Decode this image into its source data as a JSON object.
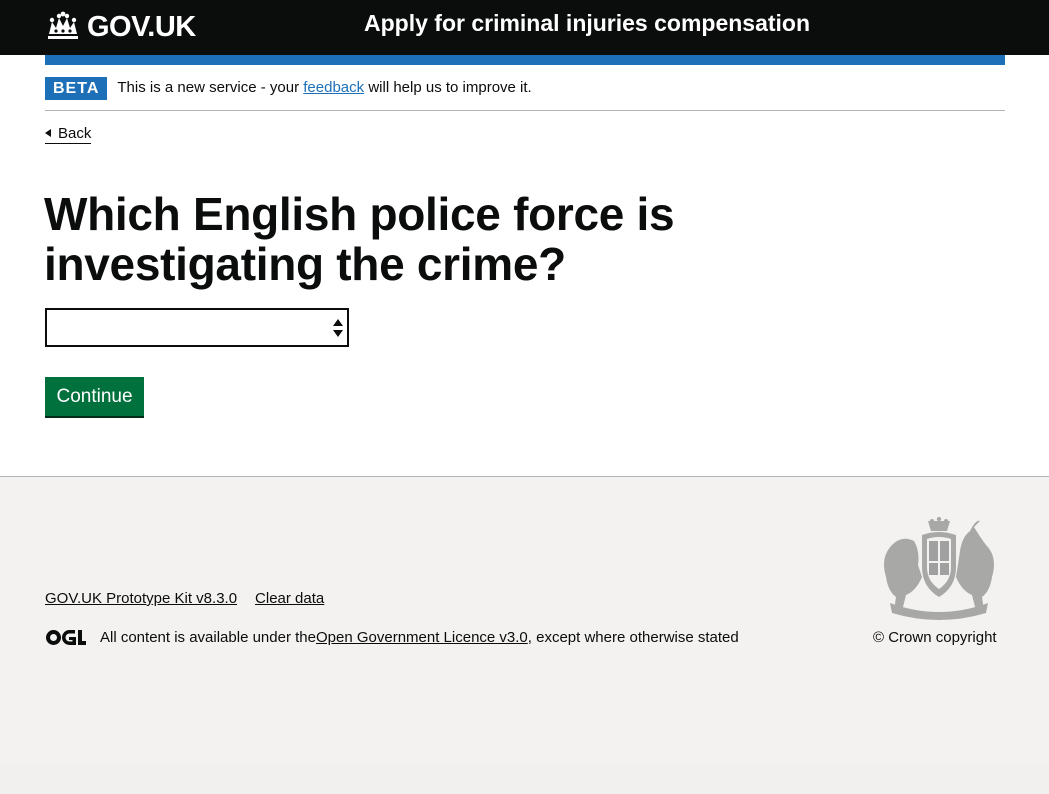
{
  "header": {
    "logo_text": "GOV.UK",
    "service_name": "Apply for criminal injuries compensation"
  },
  "phase_banner": {
    "tag": "BETA",
    "text_before": "This is a new service - your ",
    "link": "feedback",
    "text_after": " will help us to improve it."
  },
  "back_link": "Back",
  "question": "Which English police force is investigating the crime?",
  "select": {
    "value": ""
  },
  "continue_button": "Continue",
  "footer": {
    "links": [
      "GOV.UK Prototype Kit v8.3.0",
      "Clear data"
    ],
    "licence_before": "All content is available under the ",
    "licence_link": "Open Government Licence v3.0",
    "licence_after": ", except where otherwise stated",
    "copyright": "© Crown copyright"
  },
  "colors": {
    "header_bg": "#0b0c0c",
    "accent_blue": "#1d70b8",
    "button_green": "#00703c",
    "footer_bg": "#f3f2f1"
  },
  "icons": [
    "crown-icon",
    "chevron-left-icon",
    "select-arrows-icon",
    "ogl-logo",
    "royal-coat-of-arms"
  ]
}
